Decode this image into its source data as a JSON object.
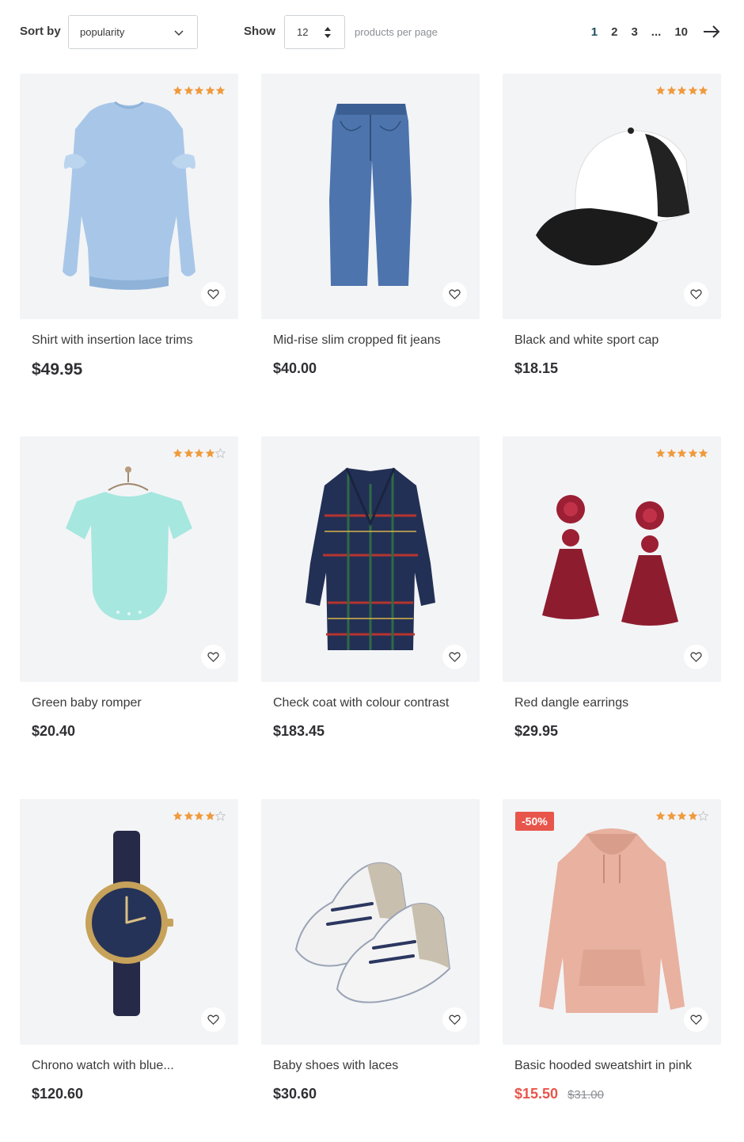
{
  "toolbar": {
    "sort_label": "Sort by",
    "sort_value": "popularity",
    "show_label": "Show",
    "per_page_value": "12",
    "per_page_text": "products per page",
    "pages": [
      "1",
      "2",
      "3"
    ],
    "ellipsis": "...",
    "last_page": "10",
    "current_page": "1"
  },
  "colors": {
    "star": "#ef9a3c",
    "star_empty": "#c7c9cc",
    "sale": "#e8564b",
    "card_bg": "#f3f4f6"
  },
  "products": [
    {
      "name": "Shirt with insertion lace trims",
      "price": "$49.95",
      "rating": 5,
      "icon": "sweater-image"
    },
    {
      "name": "Mid-rise slim cropped fit jeans",
      "price": "$40.00",
      "rating": 0,
      "icon": "jeans-image"
    },
    {
      "name": "Black and white sport cap",
      "price": "$18.15",
      "rating": 5,
      "icon": "cap-image"
    },
    {
      "name": "Green baby romper",
      "price": "$20.40",
      "rating": 4,
      "icon": "romper-image"
    },
    {
      "name": "Check coat with colour contrast",
      "price": "$183.45",
      "rating": 0,
      "icon": "coat-image"
    },
    {
      "name": "Red dangle earrings",
      "price": "$29.95",
      "rating": 5,
      "icon": "earrings-image"
    },
    {
      "name": "Chrono watch with blue...",
      "price": "$120.60",
      "rating": 4,
      "icon": "watch-image"
    },
    {
      "name": "Baby shoes with laces",
      "price": "$30.60",
      "rating": 0,
      "icon": "shoes-image"
    },
    {
      "name": "Basic hooded sweatshirt in pink",
      "price": "$15.50",
      "old_price": "$31.00",
      "badge": "-50%",
      "rating": 4,
      "icon": "hoodie-image"
    }
  ]
}
